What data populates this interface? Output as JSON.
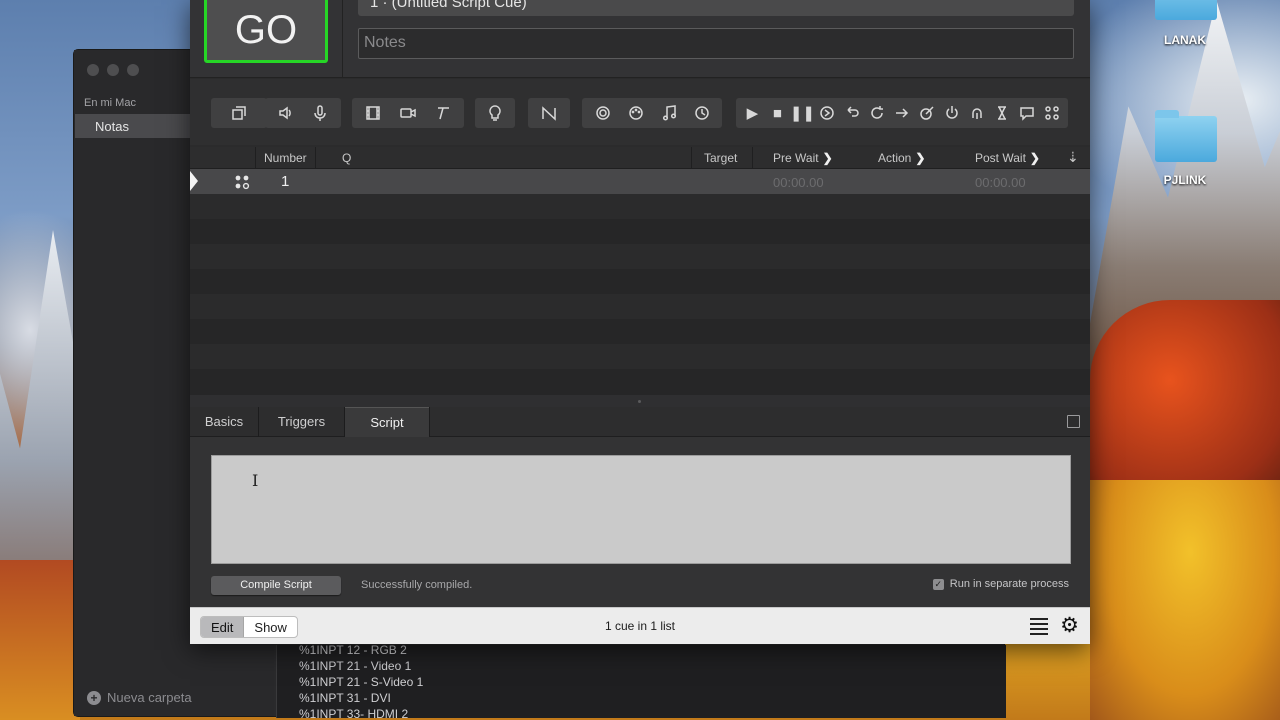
{
  "desktop": {
    "icons": [
      {
        "label": "LANAK"
      },
      {
        "label": "PJLINK"
      }
    ]
  },
  "finder": {
    "sidebar_heading": "En mi Mac",
    "sidebar_item": "Notas",
    "new_folder": "Nueva carpeta",
    "content_lines": [
      "%1INPT 12 - RGB 2",
      "%1INPT 21 - Video 1",
      "%1INPT 21 - S-Video 1",
      "%1INPT 31 - DVI",
      "%1INPT 33- HDMI 2"
    ]
  },
  "qlab": {
    "go_label": "GO",
    "cue_name": "1 · (Untitled Script Cue)",
    "notes_placeholder": "Notes",
    "columns": {
      "number": "Number",
      "q": "Q",
      "target": "Target",
      "pre_wait": "Pre Wait",
      "action": "Action",
      "post_wait": "Post Wait"
    },
    "cues": [
      {
        "number": "1",
        "name": "",
        "pre_wait": "00:00.00",
        "post_wait": "00:00.00"
      }
    ],
    "tabs": [
      "Basics",
      "Triggers",
      "Script"
    ],
    "active_tab": "Script",
    "compile_button": "Compile Script",
    "compile_status": "Successfully compiled.",
    "separate_process_label": "Run in separate process",
    "separate_process_checked": true,
    "footer": {
      "edit": "Edit",
      "show": "Show",
      "cue_count": "1 cue in 1 list"
    },
    "accent_go": "#26d626"
  }
}
